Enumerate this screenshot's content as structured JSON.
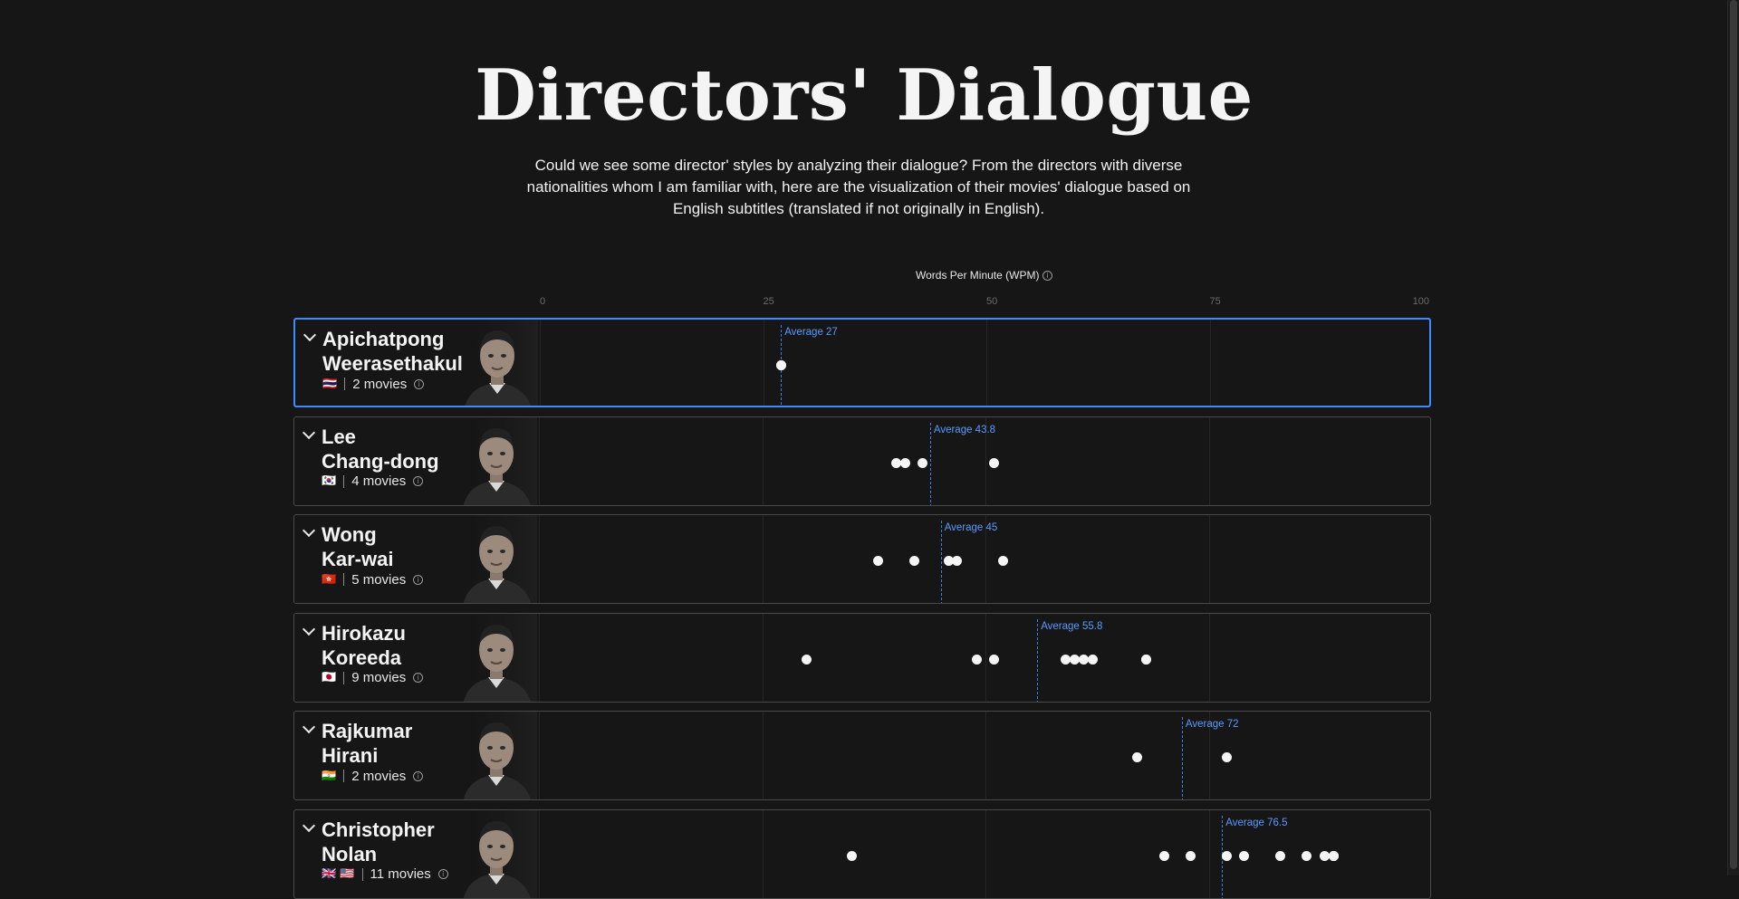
{
  "page": {
    "title": "Directors' Dialogue",
    "intro": "Could we see some director' styles by analyzing their dialogue? From the directors with diverse nationalities whom I am familiar with, here are the visualization of their movies' dialogue based on English subtitles (translated if not originally in English)."
  },
  "chart_data": {
    "type": "scatter",
    "title": "Words Per Minute (WPM)",
    "xlim": [
      0,
      100
    ],
    "ticks": [
      "0",
      "25",
      "50",
      "75",
      "100"
    ],
    "average_label_prefix": "Average",
    "accent_color": "#3d8bfd",
    "dot_color": "#f5f5f5",
    "directors": [
      {
        "first": "Apichatpong",
        "last": "Weerasethakul",
        "flags": [
          "🇹🇭"
        ],
        "movies_label": "2 movies",
        "average": 27,
        "average_text": "Average 27",
        "values": [
          27,
          27
        ],
        "selected": true
      },
      {
        "first": "Lee",
        "last": "Chang-dong",
        "flags": [
          "🇰🇷"
        ],
        "movies_label": "4 movies",
        "average": 43.8,
        "average_text": "Average 43.8",
        "values": [
          40,
          41,
          43,
          51
        ],
        "selected": false
      },
      {
        "first": "Wong",
        "last": "Kar-wai",
        "flags": [
          "🇭🇰"
        ],
        "movies_label": "5 movies",
        "average": 45,
        "average_text": "Average 45",
        "values": [
          38,
          42,
          45.9,
          46.8,
          52
        ],
        "selected": false
      },
      {
        "first": "Hirokazu",
        "last": "Koreeda",
        "flags": [
          "🇯🇵"
        ],
        "movies_label": "9 movies",
        "average": 55.8,
        "average_text": "Average 55.8",
        "values": [
          30,
          49,
          51,
          59,
          60,
          61,
          62,
          68,
          68
        ],
        "selected": false
      },
      {
        "first": "Rajkumar",
        "last": "Hirani",
        "flags": [
          "🇮🇳"
        ],
        "movies_label": "2 movies",
        "average": 72,
        "average_text": "Average 72",
        "values": [
          67,
          77
        ],
        "selected": false
      },
      {
        "first": "Christopher",
        "last": "Nolan",
        "flags": [
          "🇬🇧",
          "🇺🇸"
        ],
        "movies_label": "11 movies",
        "average": 76.5,
        "average_text": "Average 76.5",
        "values": [
          35,
          70,
          73,
          77,
          79,
          83,
          86,
          88,
          89,
          89,
          89
        ],
        "selected": false
      }
    ]
  }
}
